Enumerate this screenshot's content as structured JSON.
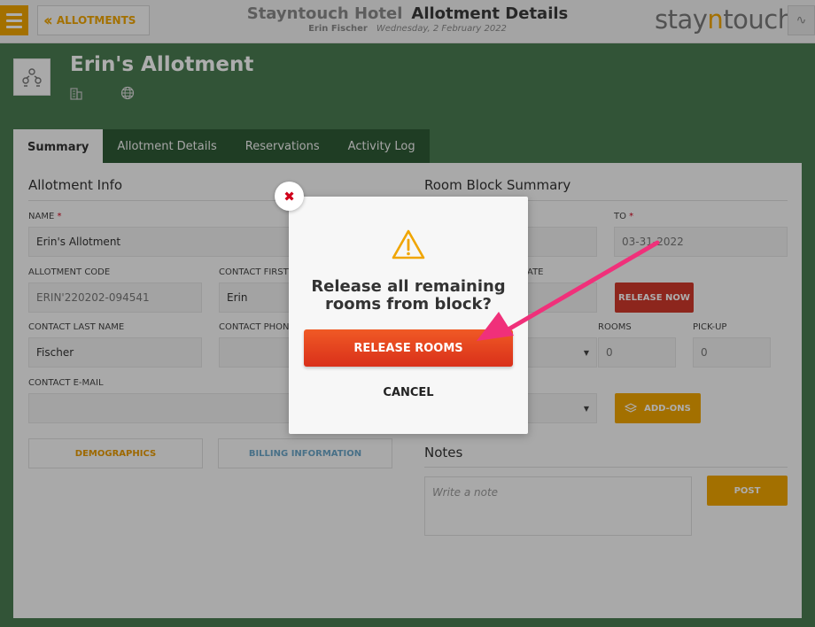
{
  "header": {
    "back_label": "ALLOTMENTS",
    "hotel_name": "Stayntouch Hotel",
    "page_title": "Allotment Details",
    "user_name": "Erin Fischer",
    "date": "Wednesday, 2 February 2022",
    "brand_a": "stay",
    "brand_b": "n",
    "brand_c": "touch"
  },
  "allotment": {
    "title": "Erin's Allotment"
  },
  "tabs": [
    {
      "label": "Summary",
      "active": true
    },
    {
      "label": "Allotment Details",
      "active": false
    },
    {
      "label": "Reservations",
      "active": false
    },
    {
      "label": "Activity Log",
      "active": false
    }
  ],
  "info": {
    "section_title": "Allotment Info",
    "name_label": "NAME",
    "name_value": "Erin's Allotment",
    "code_label": "ALLOTMENT CODE",
    "code_value": "ERIN'220202-094541",
    "contact_first_label": "CONTACT FIRST",
    "contact_first_value": "Erin",
    "contact_last_label": "CONTACT LAST NAME",
    "contact_last_value": "Fischer",
    "contact_phone_label": "CONTACT PHON",
    "contact_email_label": "CONTACT E-MAIL",
    "demographics_label": "DEMOGRAPHICS",
    "billing_label": "BILLING INFORMATION"
  },
  "room_block": {
    "section_title": "Room Block Summary",
    "to_label": "TO",
    "to_value": "03-31-2022",
    "ate_label": "ATE",
    "release_now_label": "RELEASE NOW",
    "rooms_label": "ROOMS",
    "rooms_value": "0",
    "pickup_label": "PICK-UP",
    "pickup_value": "0",
    "addons_label": "ADD-ONS"
  },
  "notes": {
    "section_title": "Notes",
    "placeholder": "Write a note",
    "post_label": "POST"
  },
  "modal": {
    "message_line1": "Release all remaining",
    "message_line2": "rooms from block?",
    "release_label": "RELEASE ROOMS",
    "cancel_label": "CANCEL"
  },
  "colors": {
    "accent": "#f0a500",
    "background": "#4a7c52",
    "danger": "#d0392b",
    "annotation": "#f0307a"
  }
}
